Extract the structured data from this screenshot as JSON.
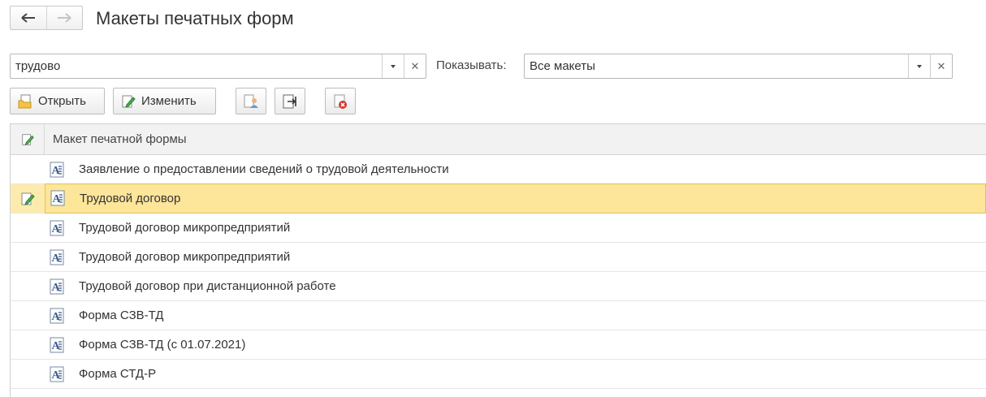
{
  "window": {
    "title": "Макеты печатных форм"
  },
  "nav": {
    "back_icon": "arrow-left-icon",
    "forward_icon": "arrow-right-icon"
  },
  "search": {
    "value": "трудово"
  },
  "filter": {
    "label": "Показывать:",
    "value": "Все макеты"
  },
  "toolbar": {
    "open_label": "Открыть",
    "edit_label": "Изменить",
    "icons": [
      "user-template-icon",
      "export-file-icon",
      "delete-template-icon"
    ]
  },
  "table": {
    "header": "Макет печатной формы",
    "selected_index": 1,
    "rows": [
      {
        "label": "Заявление о предоставлении сведений о трудовой деятельности"
      },
      {
        "label": "Трудовой договор"
      },
      {
        "label": "Трудовой договор микропредприятий"
      },
      {
        "label": "Трудовой договор микропредприятий"
      },
      {
        "label": "Трудовой договор при дистанционной работе"
      },
      {
        "label": "Форма СЗВ-ТД"
      },
      {
        "label": "Форма СЗВ-ТД (с 01.07.2021)"
      },
      {
        "label": "Форма СТД-Р"
      }
    ]
  },
  "colors": {
    "selection": "#fde59a",
    "selection_border": "#e2c15a",
    "header_bg": "#f2f2f2"
  }
}
